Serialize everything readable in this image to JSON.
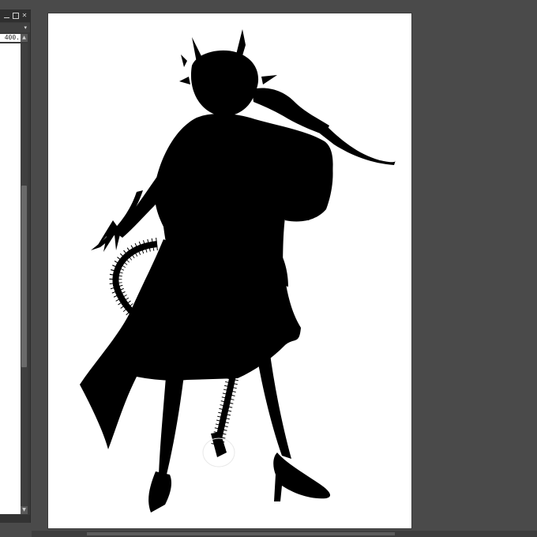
{
  "palette": {
    "value": "400.",
    "dropdown_icon": "chevron-down-icon",
    "window_controls": [
      "minimize",
      "maximize",
      "close"
    ]
  },
  "canvas": {
    "background": "#ffffff",
    "artwork": "silhouette"
  },
  "colors": {
    "workspace": "#4a4a4a",
    "panel": "#3a3a3a",
    "silhouette": "#000000"
  }
}
